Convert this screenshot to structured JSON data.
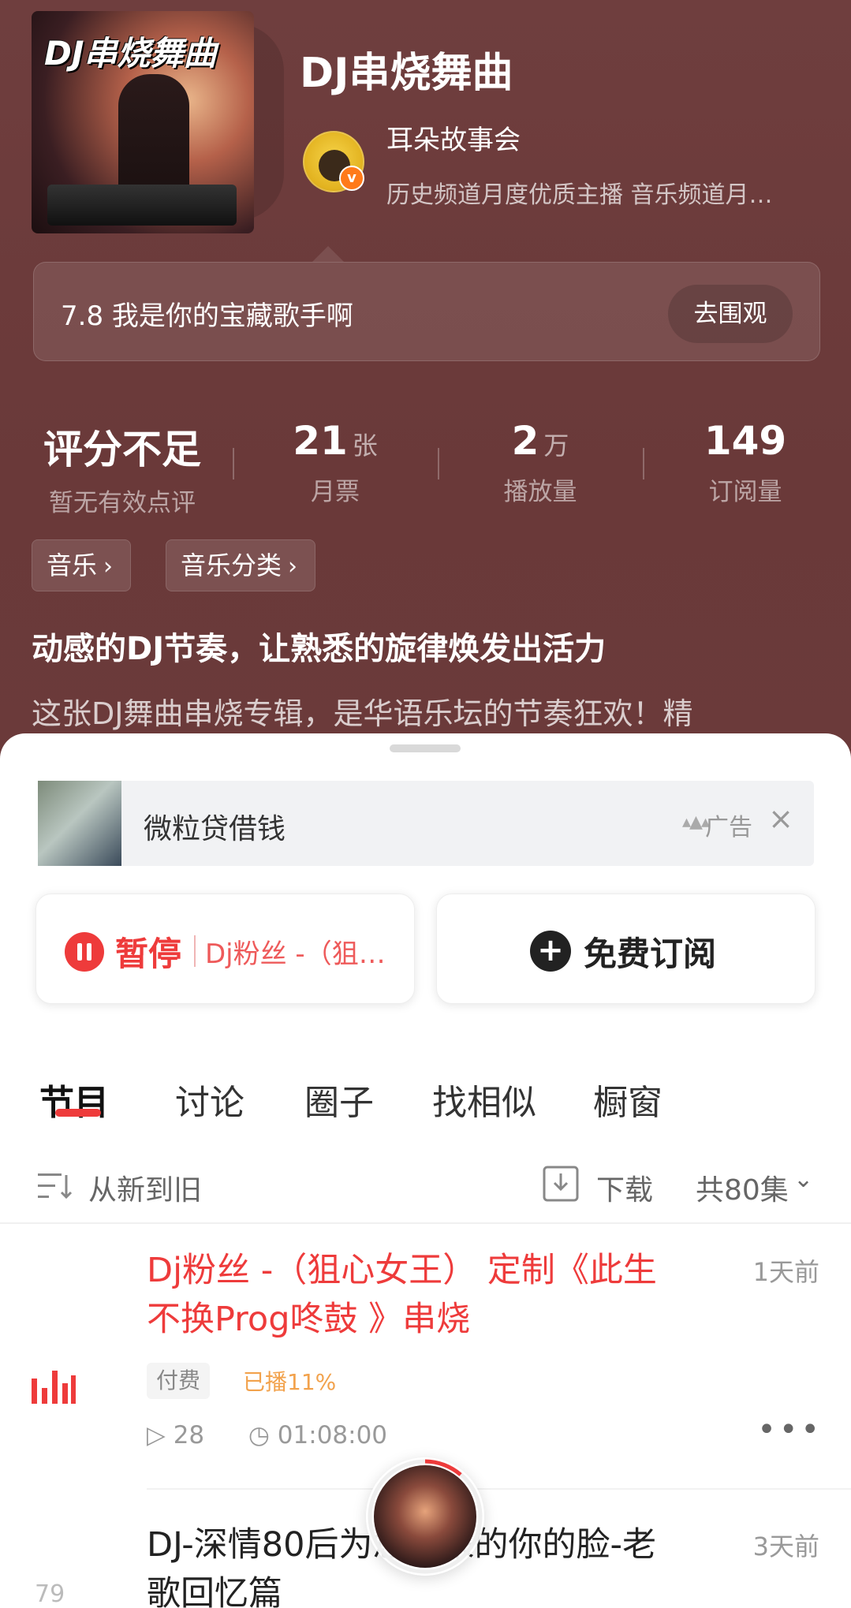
{
  "album": {
    "cover_text": "DJ串烧舞曲",
    "title": "DJ串烧舞曲"
  },
  "host": {
    "name": "耳朵故事会",
    "description": "历史频道月度优质主播  音乐频道月…",
    "verified_mark": "v"
  },
  "notice": {
    "text": "7.8 我是你的宝藏歌手啊",
    "button": "去围观"
  },
  "stats": [
    {
      "value": "评分不足",
      "unit": "",
      "label": "暂无有效点评"
    },
    {
      "value": "21",
      "unit": "张",
      "label": "月票"
    },
    {
      "value": "2",
      "unit": "万",
      "label": "播放量"
    },
    {
      "value": "149",
      "unit": "",
      "label": "订阅量"
    }
  ],
  "tags": [
    "音乐",
    "音乐分类"
  ],
  "description": {
    "title": "动感的DJ节奏，让熟悉的旋律焕发出活力",
    "body": "这张DJ舞曲串烧专辑，是华语乐坛的节奏狂欢！精"
  },
  "ad": {
    "text": "微粒贷借钱",
    "label": "广告",
    "close": "×"
  },
  "player": {
    "state_label": "暂停",
    "track": "Dj粉丝 -（狙心女王） 定制《此生不换Prog咚鼓》串烧"
  },
  "subscribe": {
    "icon": "+",
    "label": "免费订阅"
  },
  "tabs": [
    "节目",
    "讨论",
    "圈子",
    "找相似",
    "橱窗"
  ],
  "active_tab": "节目",
  "list_controls": {
    "sort": "从新到旧",
    "download": "下载",
    "count": "共80集"
  },
  "episodes": [
    {
      "title": "Dj粉丝 -（狙心女王） 定制《此生不换Prog咚鼓 》串烧",
      "date": "1天前",
      "badge": "付费",
      "progress": "已播11%",
      "plays": "28",
      "duration": "01:08:00",
      "playing": true
    },
    {
      "title": "DJ-深情80后为您而来的你的脸-老歌回忆篇",
      "date": "3天前",
      "number": "79"
    }
  ],
  "colors": {
    "accent": "#ee3b3b",
    "header_bg": "#6a3939",
    "played_orange": "#f2a24c"
  }
}
